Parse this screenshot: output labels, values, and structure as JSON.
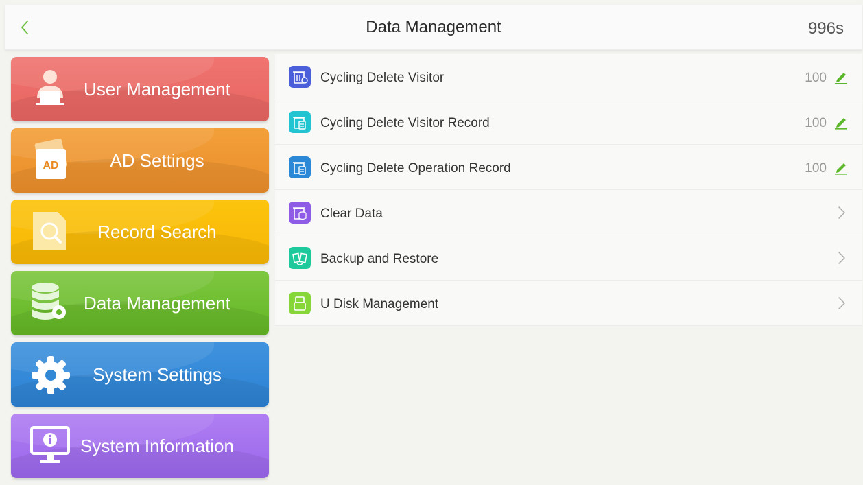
{
  "header": {
    "title": "Data Management",
    "timer": "996s"
  },
  "sidebar": {
    "items": [
      {
        "label": "User Management",
        "icon": "user-icon"
      },
      {
        "label": "AD Settings",
        "icon": "ad-icon",
        "badge": "AD"
      },
      {
        "label": "Record Search",
        "icon": "search-document-icon"
      },
      {
        "label": "Data Management",
        "icon": "database-gear-icon"
      },
      {
        "label": "System Settings",
        "icon": "gear-icon"
      },
      {
        "label": "System Information",
        "icon": "monitor-info-icon"
      }
    ]
  },
  "list": {
    "rows": [
      {
        "label": "Cycling Delete Visitor",
        "value": "100",
        "icon": "cycling-delete-visitor-icon",
        "color": "#4a5fd9"
      },
      {
        "label": "Cycling Delete Visitor Record",
        "value": "100",
        "icon": "cycling-delete-record-icon",
        "color": "#23c4d2"
      },
      {
        "label": "Cycling Delete Operation Record",
        "value": "100",
        "icon": "cycling-delete-operation-icon",
        "color": "#2a88d6"
      },
      {
        "label": "Clear Data",
        "icon": "clear-data-icon",
        "color": "#8d5be6"
      },
      {
        "label": "Backup and Restore",
        "icon": "backup-restore-icon",
        "color": "#1ec99b"
      },
      {
        "label": "U Disk Management",
        "icon": "usb-disk-icon",
        "color": "#86d63a"
      }
    ]
  },
  "colors": {
    "accent_green": "#5cb82a"
  }
}
